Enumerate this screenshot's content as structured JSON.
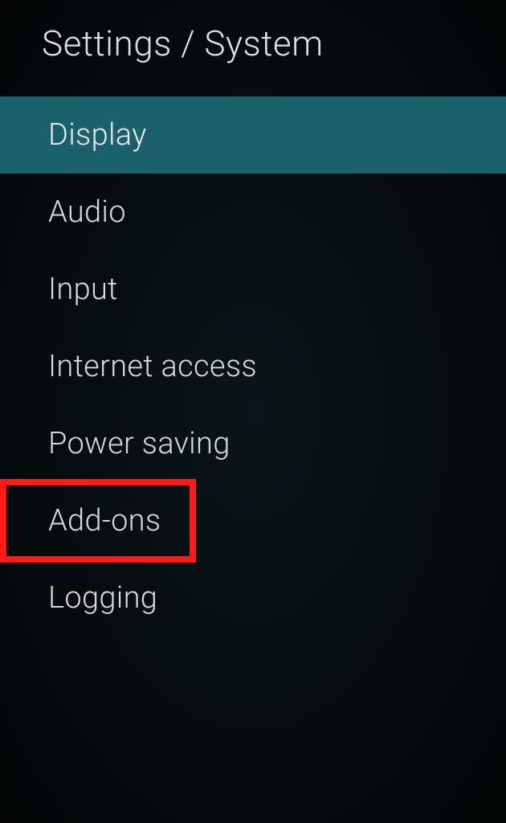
{
  "header": {
    "breadcrumb": "Settings / System"
  },
  "menu": {
    "items": [
      {
        "label": "Display",
        "selected": true,
        "highlighted": false
      },
      {
        "label": "Audio",
        "selected": false,
        "highlighted": false
      },
      {
        "label": "Input",
        "selected": false,
        "highlighted": false
      },
      {
        "label": "Internet access",
        "selected": false,
        "highlighted": false
      },
      {
        "label": "Power saving",
        "selected": false,
        "highlighted": false
      },
      {
        "label": "Add-ons",
        "selected": false,
        "highlighted": true
      },
      {
        "label": "Logging",
        "selected": false,
        "highlighted": false
      }
    ]
  },
  "colors": {
    "selected_bg": "#1a616b",
    "highlight_border": "#ff1a1a"
  }
}
